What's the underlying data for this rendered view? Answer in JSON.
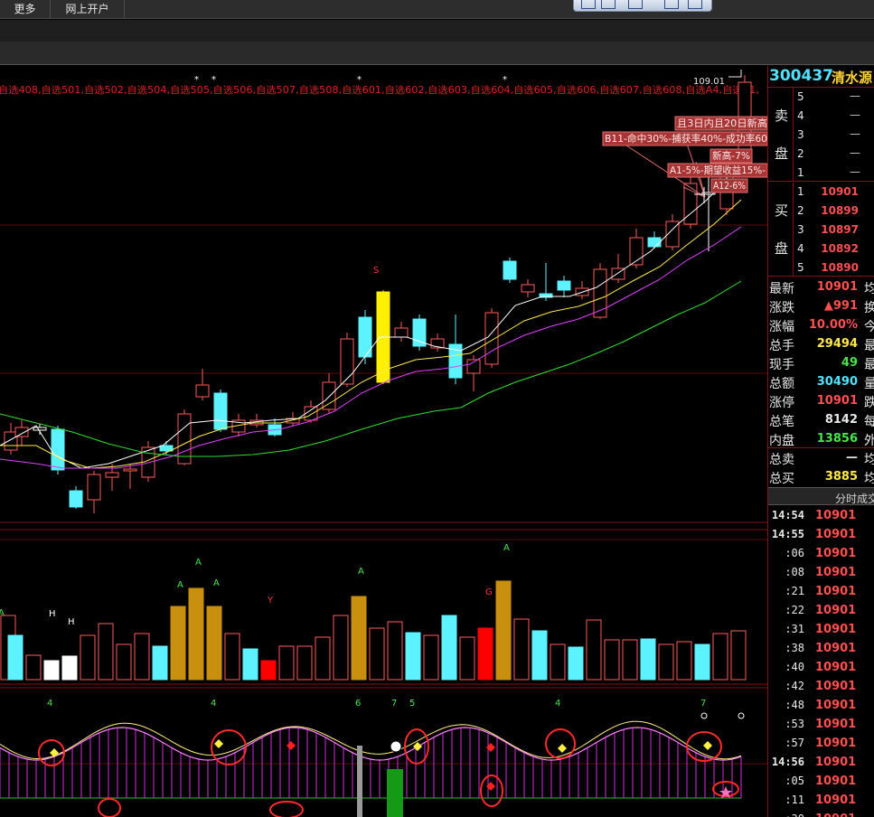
{
  "menu": {
    "more": "更多",
    "open_account": "网上开户"
  },
  "chart": {
    "favorites_row": "自选408,自选501,自选502,自选504,自选505,自选506,自选507,自选508,自选601,自选602,自选603,自选604,自选605,自选606,自选607,自选608,自选A4,自选B1,",
    "price_label": "109.01",
    "annotations": [
      "且3日内且20日新高",
      "B11-命中30%-捕获率40%-成功率60",
      "新高-7%",
      "A1-5%-期望收益15%-",
      "A12-6%"
    ],
    "s_marker": "S",
    "volume_markers": {
      "a": "A",
      "h": "H",
      "y": "Y",
      "g": "G"
    },
    "indicator_numbers": [
      "4",
      "4",
      "6",
      "7",
      "5",
      "4",
      "7"
    ]
  },
  "stock": {
    "code": "300437",
    "name": "清水源"
  },
  "sell_book": {
    "title_top": "卖",
    "title_bottom": "盘",
    "levels": [
      {
        "level": "5",
        "price": "—"
      },
      {
        "level": "4",
        "price": "—"
      },
      {
        "level": "3",
        "price": "—"
      },
      {
        "level": "2",
        "price": "—"
      },
      {
        "level": "1",
        "price": "—"
      }
    ]
  },
  "buy_book": {
    "title_top": "买",
    "title_bottom": "盘",
    "levels": [
      {
        "level": "1",
        "price": "10901"
      },
      {
        "level": "2",
        "price": "10899"
      },
      {
        "level": "3",
        "price": "10897"
      },
      {
        "level": "4",
        "price": "10892"
      },
      {
        "level": "5",
        "price": "10890"
      }
    ]
  },
  "stats": [
    {
      "label": "最新",
      "value": "10901",
      "color": "#ff5050",
      "cut": "均"
    },
    {
      "label": "涨跌",
      "value": "▲991",
      "color": "#ff5050",
      "cut": "换"
    },
    {
      "label": "涨幅",
      "value": "10.00%",
      "color": "#ff5050",
      "cut": "今"
    },
    {
      "label": "总手",
      "value": "29494",
      "color": "#ffe94a",
      "cut": "最"
    },
    {
      "label": "现手",
      "value": "49",
      "color": "#49e34a",
      "cut": "最"
    },
    {
      "label": "总额",
      "value": "30490",
      "color": "#4fe3ff",
      "cut": "量"
    },
    {
      "label": "涨停",
      "value": "10901",
      "color": "#ff5050",
      "cut": "跌"
    },
    {
      "label": "总笔",
      "value": "8142",
      "color": "#e8e8e8",
      "cut": "每"
    },
    {
      "label": "内盘",
      "value": "13856",
      "color": "#49e34a",
      "cut": "外"
    },
    {
      "label": "总卖",
      "value": "—",
      "color": "#e8e8e8",
      "cut": "均"
    },
    {
      "label": "总买",
      "value": "3885",
      "color": "#ffe94a",
      "cut": "均"
    }
  ],
  "ticks": {
    "header": "分时成交",
    "rows": [
      {
        "time": "14:54",
        "price": "10901"
      },
      {
        "time": "14:55",
        "price": "10901"
      },
      {
        "time": ":06",
        "price": "10901"
      },
      {
        "time": ":08",
        "price": "10901"
      },
      {
        "time": ":21",
        "price": "10901"
      },
      {
        "time": ":22",
        "price": "10901"
      },
      {
        "time": ":31",
        "price": "10901"
      },
      {
        "time": ":38",
        "price": "10901"
      },
      {
        "time": ":40",
        "price": "10901"
      },
      {
        "time": ":42",
        "price": "10901"
      },
      {
        "time": ":48",
        "price": "10901"
      },
      {
        "time": ":53",
        "price": "10901"
      },
      {
        "time": ":57",
        "price": "10901"
      },
      {
        "time": "14:56",
        "price": "10901"
      },
      {
        "time": ":05",
        "price": "10901"
      },
      {
        "time": ":11",
        "price": "10901"
      },
      {
        "time": ":30",
        "price": "10901"
      }
    ]
  }
}
